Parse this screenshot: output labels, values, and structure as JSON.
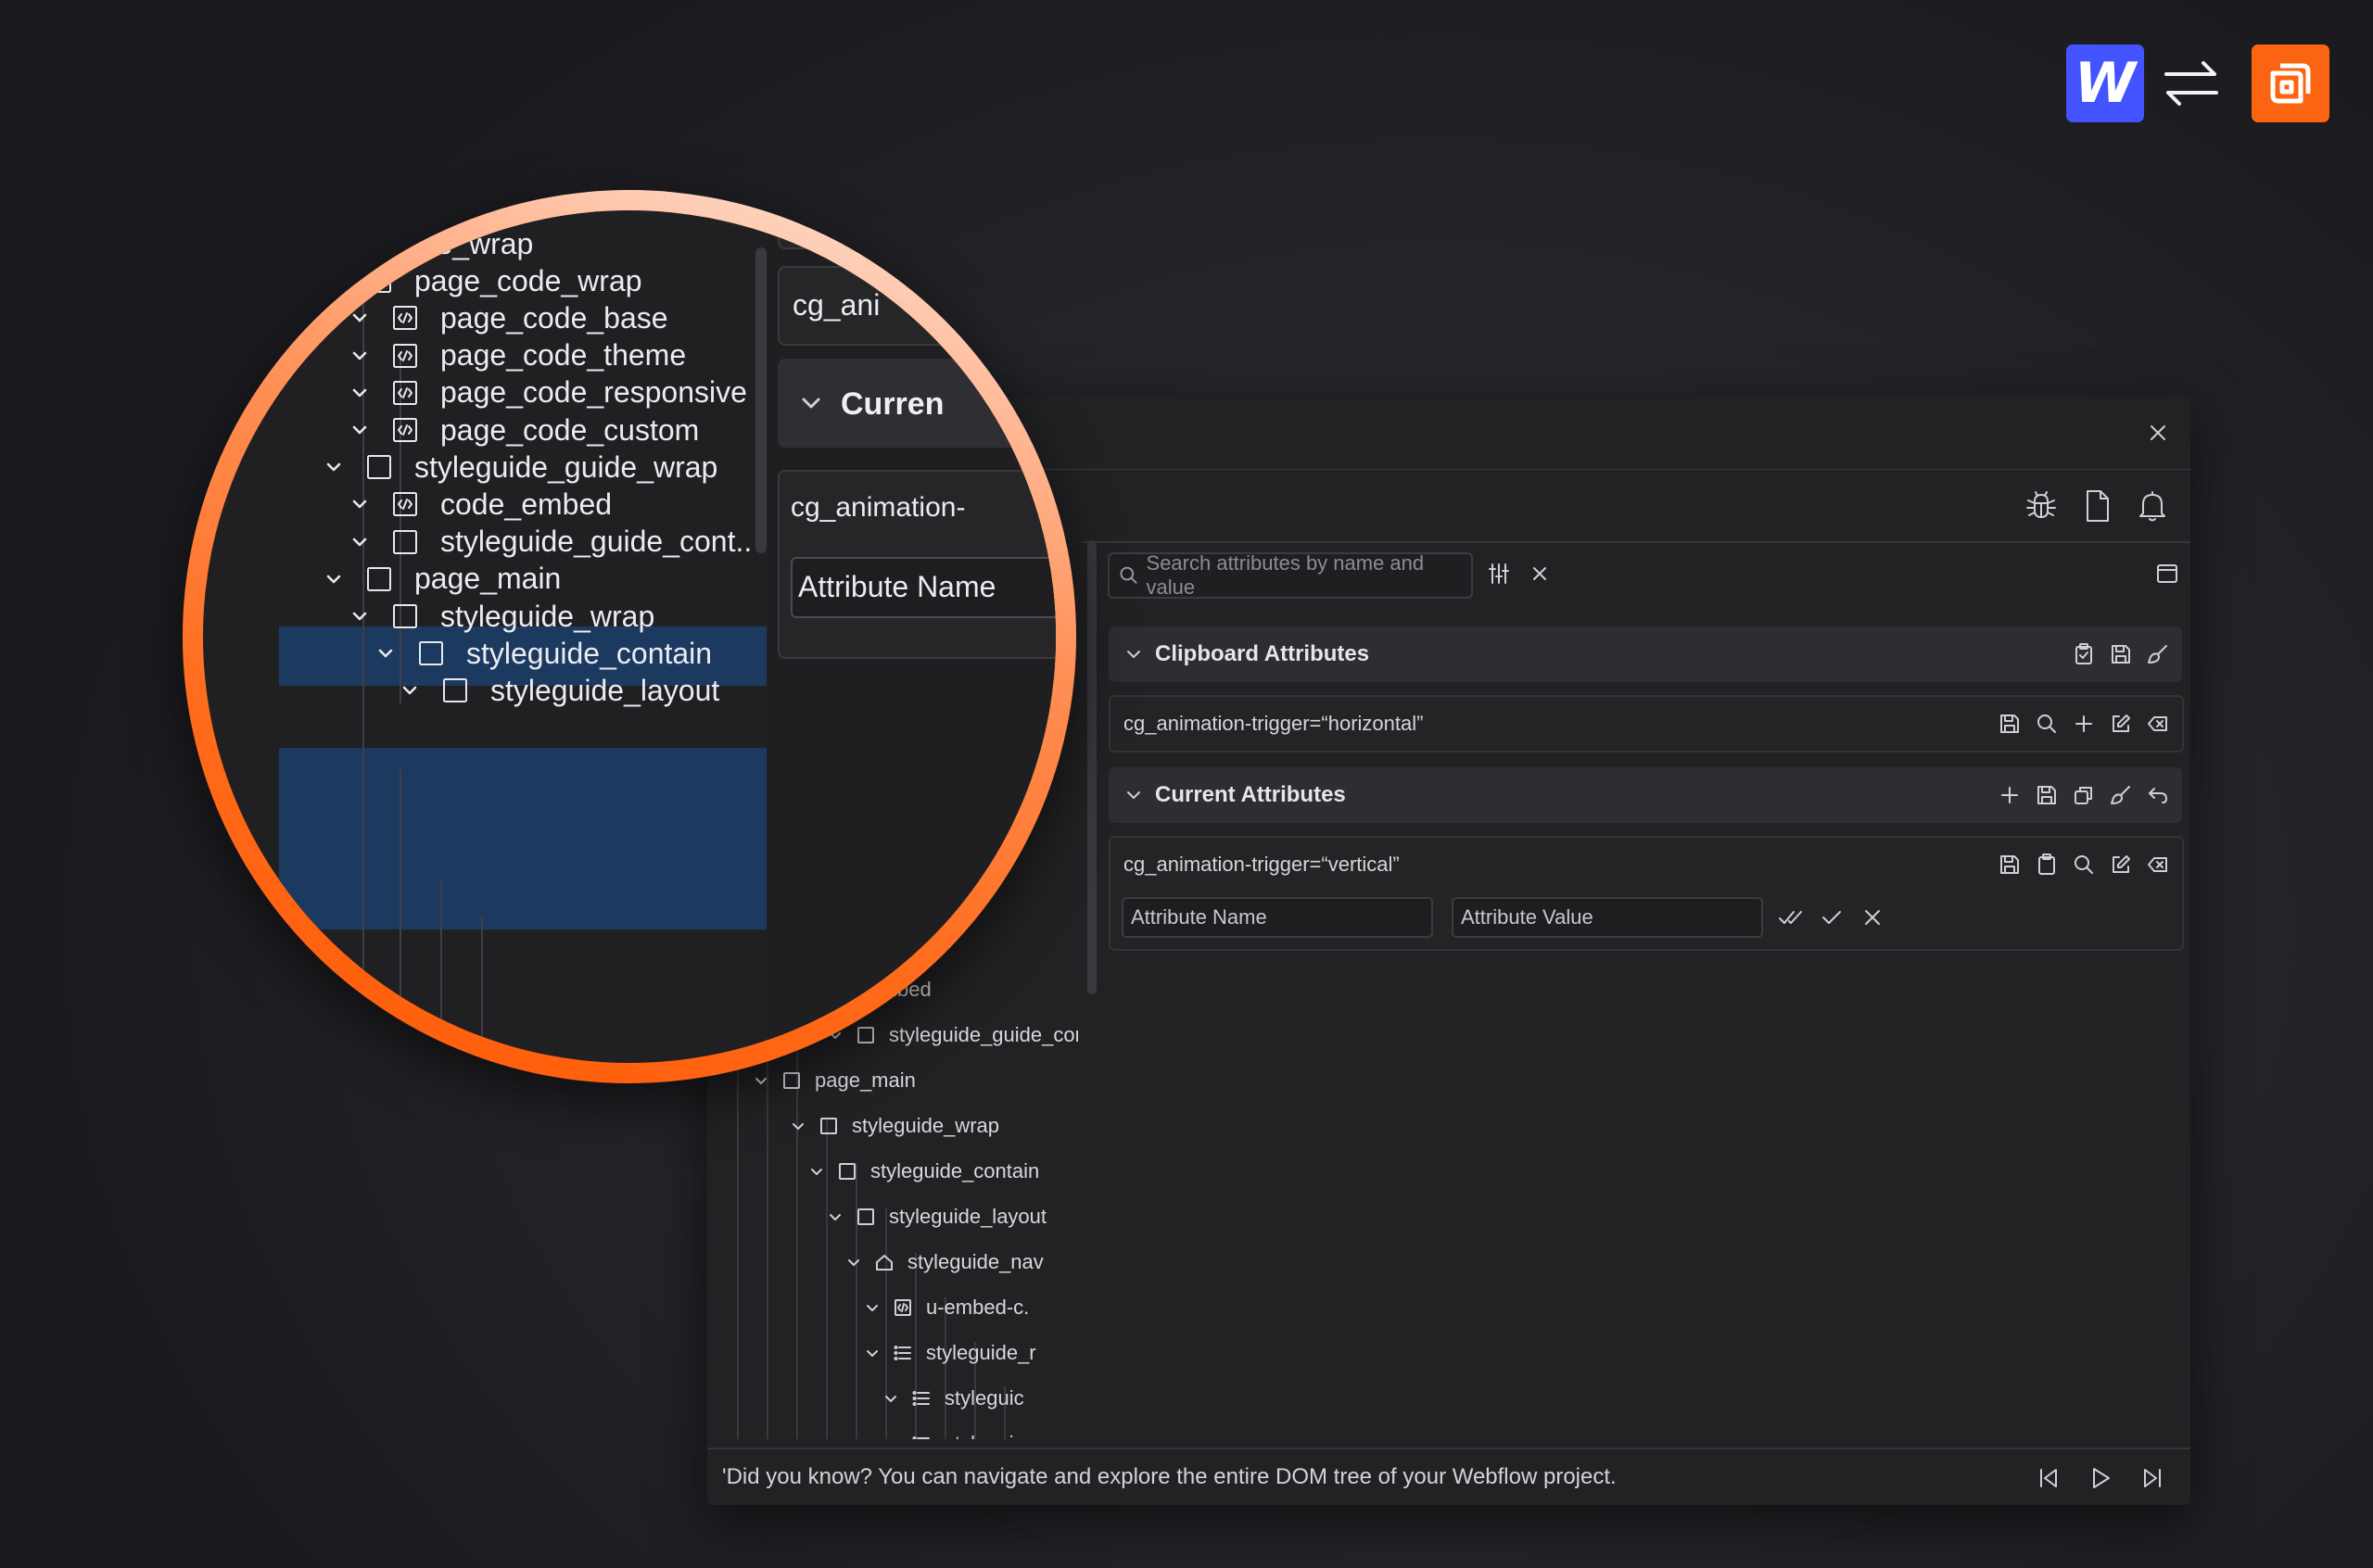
{
  "brand": {
    "webflow_logo": "W",
    "webflow_color": "#4353ff",
    "plugin_color": "#fb6512",
    "swap_icon": "swap-arrows-icon"
  },
  "toolbar": {
    "icons": [
      "bug-icon",
      "file-icon",
      "bell-icon"
    ]
  },
  "search": {
    "placeholder": "Search attributes by name and value"
  },
  "clipboard": {
    "title": "Clipboard Attributes",
    "attribute": "cg_animation-trigger=“horizontal”"
  },
  "current": {
    "title": "Current Attributes",
    "attribute": "cg_animation-trigger=“vertical”",
    "name_placeholder": "Attribute Name",
    "value_placeholder": "Attribute Value"
  },
  "tree": {
    "items": [
      {
        "label": "ponsive"
      },
      {
        "label": "ustom"
      },
      {
        "label": "guide_wrap"
      },
      {
        "label": "e_embed"
      },
      {
        "label": "styleguide_guide_cont.."
      },
      {
        "label": "page_main"
      },
      {
        "label": "styleguide_wrap"
      },
      {
        "label": "styleguide_contain"
      },
      {
        "label": "styleguide_layout"
      },
      {
        "label": "styleguide_nav"
      },
      {
        "label": "u-embed-c."
      },
      {
        "label": "styleguide_r"
      },
      {
        "label": "styleguic"
      },
      {
        "label": "styleguic"
      }
    ]
  },
  "status": {
    "message": "'Did you know? You can navigate and explore the entire DOM tree of your Webflow project."
  },
  "magnifier": {
    "items": [
      {
        "label": "page_wrap"
      },
      {
        "label": "page_code_wrap"
      },
      {
        "label": "page_code_base"
      },
      {
        "label": "page_code_theme"
      },
      {
        "label": "page_code_responsive"
      },
      {
        "label": "page_code_custom"
      },
      {
        "label": "styleguide_guide_wrap"
      },
      {
        "label": "code_embed"
      },
      {
        "label": "styleguide_guide_cont.."
      },
      {
        "label": "page_main"
      },
      {
        "label": "styleguide_wrap"
      },
      {
        "label": "styleguide_contain"
      },
      {
        "label": "styleguide_layout"
      }
    ],
    "right_top": "cg_ani",
    "right_section": "Curren",
    "right_attr": "cg_animation-",
    "right_input": "Attribute Name"
  }
}
